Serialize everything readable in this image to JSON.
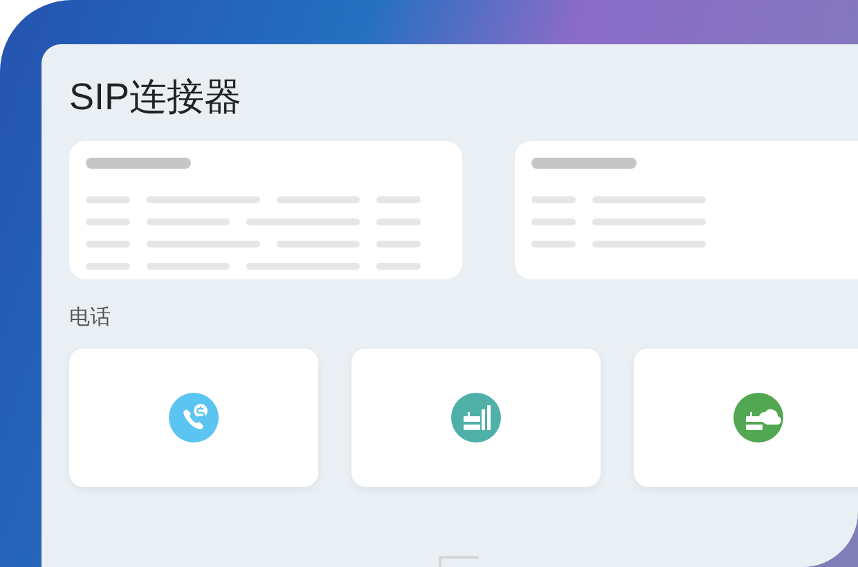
{
  "title": "SIP连接器",
  "summary_cards": [
    {
      "kind": "table"
    },
    {
      "kind": "list"
    }
  ],
  "section": {
    "label": "电话",
    "tiles": [
      {
        "kind": "phone-dollar",
        "color": "#5bc4f1"
      },
      {
        "kind": "server-bars",
        "color": "#4fb0a8"
      },
      {
        "kind": "server-cloud",
        "color": "#52a852"
      }
    ]
  }
}
